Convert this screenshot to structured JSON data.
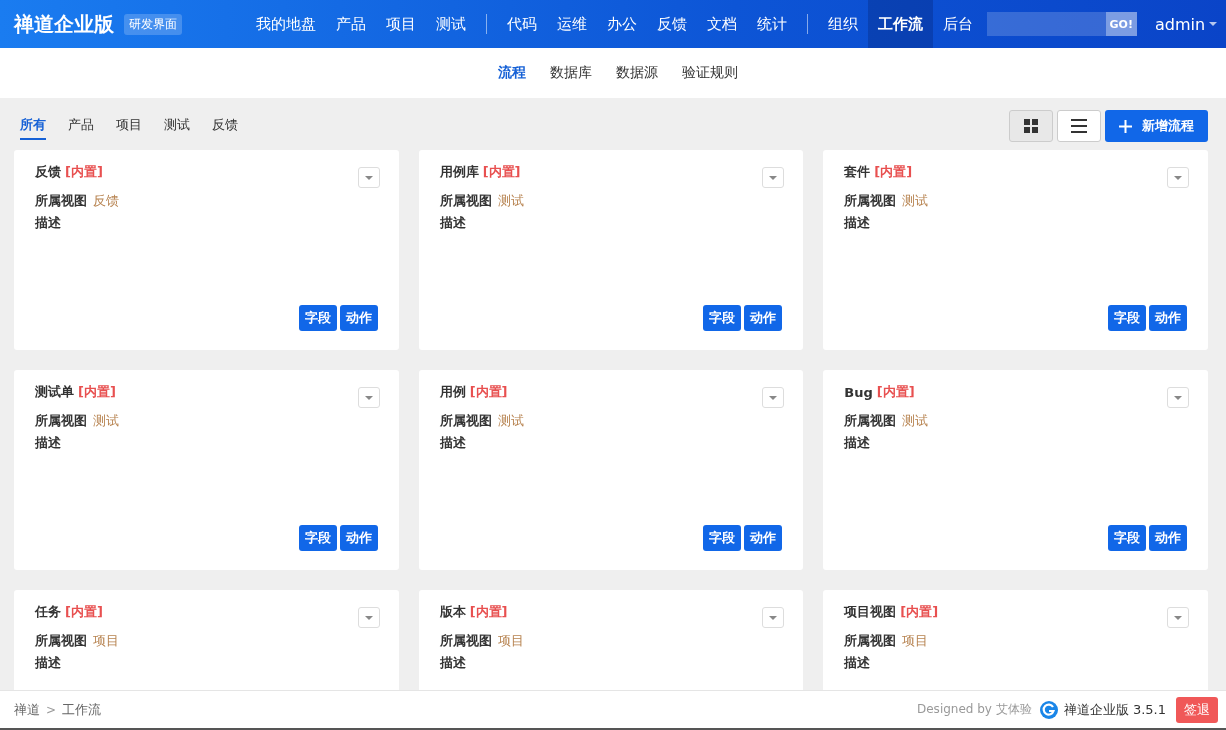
{
  "header": {
    "brand": "禅道企业版",
    "badge": "研发界面",
    "nav_groups": [
      [
        {
          "label": "我的地盘",
          "selected": false
        },
        {
          "label": "产品",
          "selected": false
        },
        {
          "label": "项目",
          "selected": false
        },
        {
          "label": "测试",
          "selected": false
        }
      ],
      [
        {
          "label": "代码",
          "selected": false
        },
        {
          "label": "运维",
          "selected": false
        },
        {
          "label": "办公",
          "selected": false
        },
        {
          "label": "反馈",
          "selected": false
        },
        {
          "label": "文档",
          "selected": false
        },
        {
          "label": "统计",
          "selected": false
        }
      ],
      [
        {
          "label": "组织",
          "selected": false
        },
        {
          "label": "工作流",
          "selected": true
        },
        {
          "label": "后台",
          "selected": false
        }
      ]
    ],
    "search_button": "GO!",
    "user": "admin"
  },
  "subnav": [
    {
      "label": "流程",
      "selected": true
    },
    {
      "label": "数据库",
      "selected": false
    },
    {
      "label": "数据源",
      "selected": false
    },
    {
      "label": "验证规则",
      "selected": false
    }
  ],
  "filters": [
    {
      "label": "所有",
      "selected": true
    },
    {
      "label": "产品",
      "selected": false
    },
    {
      "label": "项目",
      "selected": false
    },
    {
      "label": "测试",
      "selected": false
    },
    {
      "label": "反馈",
      "selected": false
    }
  ],
  "view_modes": [
    {
      "kind": "grid",
      "selected": true
    },
    {
      "kind": "list",
      "selected": false
    }
  ],
  "add_button": "新增流程",
  "flows": [
    {
      "name": "反馈",
      "tag": "[内置]",
      "view_label": "所属视图",
      "view": "反馈",
      "desc_label": "描述",
      "buttons": [
        "字段",
        "动作"
      ]
    },
    {
      "name": "用例库",
      "tag": "[内置]",
      "view_label": "所属视图",
      "view": "测试",
      "desc_label": "描述",
      "buttons": [
        "字段",
        "动作"
      ]
    },
    {
      "name": "套件",
      "tag": "[内置]",
      "view_label": "所属视图",
      "view": "测试",
      "desc_label": "描述",
      "buttons": [
        "字段",
        "动作"
      ]
    },
    {
      "name": "测试单",
      "tag": "[内置]",
      "view_label": "所属视图",
      "view": "测试",
      "desc_label": "描述",
      "buttons": [
        "字段",
        "动作"
      ]
    },
    {
      "name": "用例",
      "tag": "[内置]",
      "view_label": "所属视图",
      "view": "测试",
      "desc_label": "描述",
      "buttons": [
        "字段",
        "动作"
      ]
    },
    {
      "name": "Bug",
      "tag": "[内置]",
      "view_label": "所属视图",
      "view": "测试",
      "desc_label": "描述",
      "buttons": [
        "字段",
        "动作"
      ]
    },
    {
      "name": "任务",
      "tag": "[内置]",
      "view_label": "所属视图",
      "view": "项目",
      "desc_label": "描述"
    },
    {
      "name": "版本",
      "tag": "[内置]",
      "view_label": "所属视图",
      "view": "项目",
      "desc_label": "描述"
    },
    {
      "name": "项目视图",
      "tag": "[内置]",
      "view_label": "所属视图",
      "view": "项目",
      "desc_label": "描述"
    }
  ],
  "footer": {
    "breadcrumb": [
      "禅道",
      "工作流"
    ],
    "separator": ">",
    "designed": "Designed by 艾体验",
    "product": "禅道企业版 3.5.1",
    "logout": "签退"
  }
}
